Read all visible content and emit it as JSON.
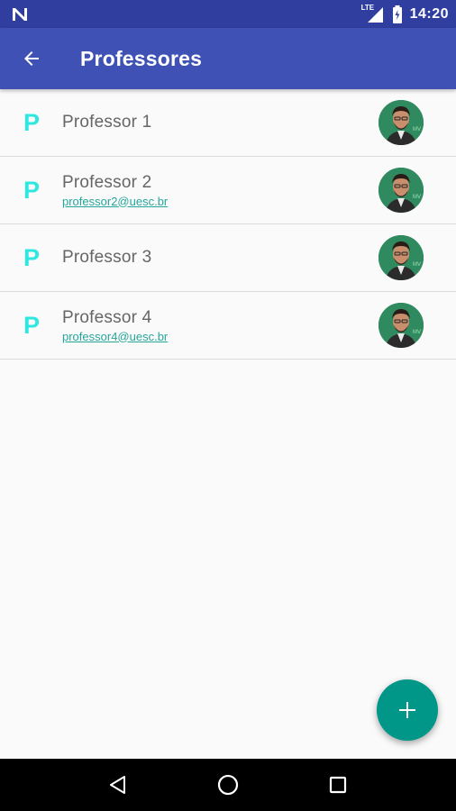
{
  "status_bar": {
    "time": "14:20",
    "network_label": "LTE",
    "icons": [
      "n-notification-icon",
      "signal-icon",
      "battery-icon"
    ]
  },
  "app_bar": {
    "title": "Professores",
    "back_icon": "arrow-back-icon",
    "color": "#3f51b5"
  },
  "professors": [
    {
      "letter": "P",
      "name": "Professor 1",
      "email": ""
    },
    {
      "letter": "P",
      "name": "Professor 2",
      "email": "professor2@uesc.br"
    },
    {
      "letter": "P",
      "name": "Professor 3",
      "email": ""
    },
    {
      "letter": "P",
      "name": "Professor 4",
      "email": "professor4@uesc.br"
    }
  ],
  "colors": {
    "letter": "#2ee8e0",
    "email": "#26a69a",
    "fab": "#009688",
    "status_bar": "#303f9f"
  },
  "fab": {
    "icon": "plus-icon"
  },
  "nav_bar": {
    "icons": [
      "back-triangle-icon",
      "home-circle-icon",
      "recents-square-icon"
    ]
  }
}
